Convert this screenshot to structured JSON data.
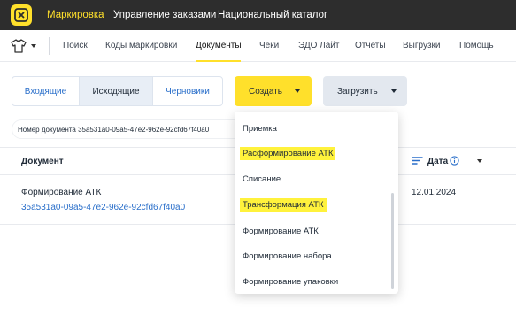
{
  "header": {
    "nav": [
      "Маркировка",
      "Управление заказами",
      "Национальный каталог"
    ]
  },
  "subnav": {
    "items": [
      "Поиск",
      "Коды маркировки",
      "Документы",
      "Чеки",
      "ЭДО Лайт",
      "Отчеты",
      "Выгрузки",
      "Помощь"
    ]
  },
  "tabs": [
    "Входящие",
    "Исходящие",
    "Черновики"
  ],
  "buttons": {
    "create": "Создать",
    "upload": "Загрузить"
  },
  "filter_chip": "Номер документа 35a531a0-09a5-47e2-962e-92cfd67f40a0",
  "table": {
    "col_document": "Документ",
    "col_date": "Дата",
    "rows": [
      {
        "title": "Формирование АТК",
        "id": "35a531a0-09a5-47e2-962e-92cfd67f40a0",
        "date": "12.01.2024"
      }
    ]
  },
  "create_menu": {
    "items": [
      "Приемка",
      "Расформирование АТК",
      "Списание",
      "Трансформация АТК",
      "Формирование АТК",
      "Формирование набора",
      "Формирование упаковки"
    ],
    "highlighted": [
      "Расформирование АТК",
      "Трансформация АТК"
    ]
  },
  "colors": {
    "accent_yellow": "#ffe02b",
    "header_bg": "#2d2d2d",
    "link_blue": "#2a6fca",
    "highlight": "#fff23c"
  }
}
